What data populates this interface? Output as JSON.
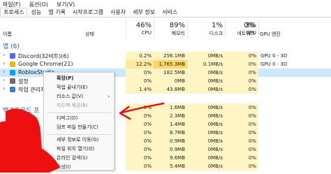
{
  "menubar": {
    "items": [
      "파일(F)",
      "옵션(O)",
      "보기(V)"
    ]
  },
  "tabs": [
    "프로세스",
    "성능",
    "앱 기록",
    "시작프로그램",
    "사용자",
    "세부 정보",
    "서비스"
  ],
  "columns": {
    "name": "이름",
    "status": "상태",
    "cpu": {
      "pct": "46%",
      "label": "CPU"
    },
    "memory": {
      "pct": "89%",
      "label": "메모리"
    },
    "disk": {
      "pct": "1%",
      "label": "디스크"
    },
    "network": {
      "pct": "0%",
      "label": "네트워크"
    },
    "gpu": {
      "pct": "3%",
      "label": "GPU"
    },
    "gpu_engine": "GPU 엔진"
  },
  "sections": {
    "apps": "앱 (6)",
    "background": "백그라운드 프"
  },
  "rows": [
    {
      "name": "Discord(32비트)(6)",
      "cpu": "0.2%",
      "memory": "256.1MB",
      "disk": "0MB/s",
      "network": "0Mbps",
      "gpu": "0%",
      "gpu_engine": "GPU 0 - 3D"
    },
    {
      "name": "Google Chrome(21)",
      "cpu": "12.2%",
      "memory": "1,765.3MB",
      "disk": "0.1MB/s",
      "network": "0Mbps",
      "gpu": "0%",
      "gpu_engine": "GPU 0 - 3D"
    },
    {
      "name": "RobloxStudio",
      "cpu": "0%",
      "memory": "182.5MB",
      "disk": "0MB/s",
      "network": "0Mbps",
      "gpu": "0%",
      "gpu_engine": ""
    },
    {
      "name": "설정",
      "cpu": "0%",
      "memory": "0MB",
      "disk": "0MB/s",
      "network": "0Mbps",
      "gpu": "0%",
      "gpu_engine": ""
    },
    {
      "name": "작업 관리자",
      "cpu": "1.4%",
      "memory": "43.8MB",
      "disk": "0MB/s",
      "network": "0Mbps",
      "gpu": "0%",
      "gpu_engine": ""
    },
    {
      "name": "",
      "cpu": "0%",
      "memory": "1.6MB",
      "disk": "0MB/s",
      "network": "0Mbps",
      "gpu": "0%",
      "gpu_engine": ""
    },
    {
      "name": "",
      "cpu": "0%",
      "memory": "2.3MB",
      "disk": "0MB/s",
      "network": "0Mbps",
      "gpu": "0%",
      "gpu_engine": ""
    },
    {
      "name": "",
      "cpu": "0%",
      "memory": "1.4MB",
      "disk": "0MB/s",
      "network": "0Mbps",
      "gpu": "0%",
      "gpu_engine": ""
    },
    {
      "name": "",
      "cpu": "0%",
      "memory": "8.7MB",
      "disk": "0MB/s",
      "network": "0Mbps",
      "gpu": "0%",
      "gpu_engine": ""
    },
    {
      "name": "",
      "cpu": "0%",
      "memory": "0.9MB",
      "disk": "0MB/s",
      "network": "0Mbps",
      "gpu": "0%",
      "gpu_engine": ""
    },
    {
      "name": "",
      "cpu": "0%",
      "memory": "0.9MB",
      "disk": "0MB/s",
      "network": "0Mbps",
      "gpu": "0%",
      "gpu_engine": ""
    },
    {
      "name": "",
      "cpu": "0%",
      "memory": "9.6MB",
      "disk": "0MB/s",
      "network": "0Mbps",
      "gpu": "0%",
      "gpu_engine": ""
    },
    {
      "name": "",
      "cpu": "0%",
      "memory": "5.4MB",
      "disk": "0MB/s",
      "network": "0Mbps",
      "gpu": "0%",
      "gpu_engine": ""
    }
  ],
  "context_menu": [
    {
      "label": "확장(P)",
      "enabled": true,
      "bold": true
    },
    {
      "label": "작업 끝내기(E)",
      "enabled": true
    },
    {
      "label": "리소스 값(V)",
      "enabled": true,
      "submenu": true
    },
    {
      "label": "피드백 제공(B)",
      "enabled": false
    },
    {
      "label": "디버그(D)",
      "enabled": true,
      "sep_before": true
    },
    {
      "label": "덤프 파일 만들기(C)",
      "enabled": true
    },
    {
      "label": "세부 정보로 이동(G)",
      "enabled": true,
      "sep_before": true
    },
    {
      "label": "파일 위치 열기(O)",
      "enabled": true
    },
    {
      "label": "온라인 검색(S)",
      "enabled": true
    },
    {
      "label": "속성(I)",
      "enabled": true
    }
  ],
  "colors": {
    "heat_light": "#fff4c4",
    "heat_mid": "#ffe79e",
    "heat_strong": "#ffd66b",
    "selected_row": "#cce8ff",
    "annotation_red": "#e51414"
  }
}
